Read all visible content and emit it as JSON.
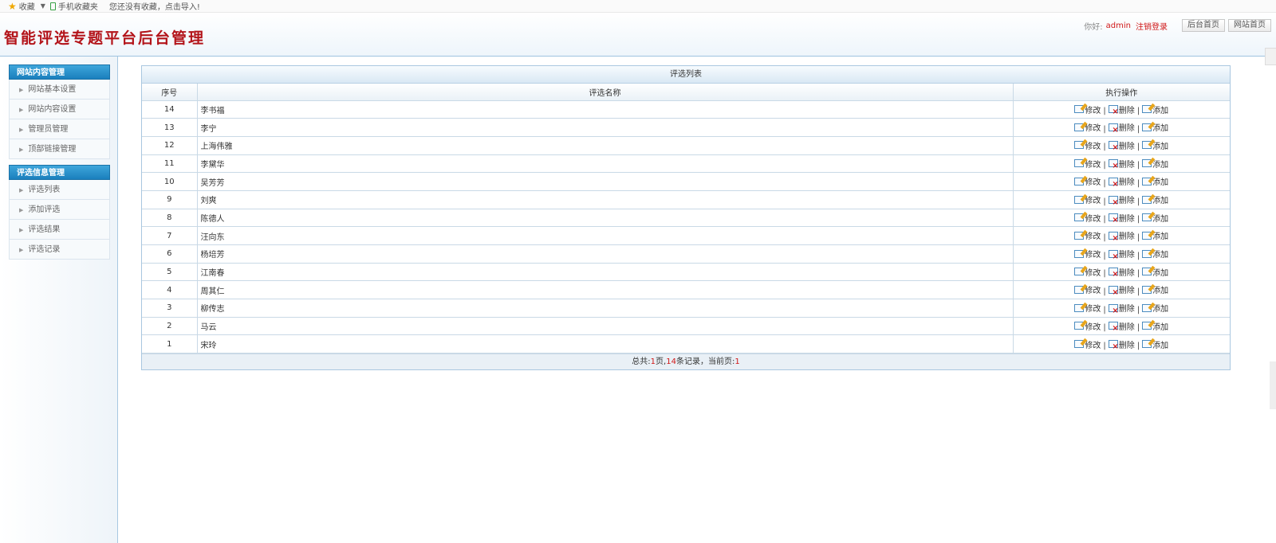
{
  "bookmark_bar": {
    "favorites_label": "收藏",
    "mobile_favorites_label": "手机收藏夹",
    "tip": "您还没有收藏，点击导入!"
  },
  "header": {
    "title": "智能评选专题平台后台管理",
    "greeting": "你好:",
    "username": "admin",
    "logout": "注销登录",
    "btn_admin_home": "后台首页",
    "btn_site_home": "网站首页"
  },
  "sidebar": {
    "groups": [
      {
        "title": "网站内容管理",
        "items": [
          "网站基本设置",
          "网站内容设置",
          "管理员管理",
          "顶部链接管理"
        ]
      },
      {
        "title": "评选信息管理",
        "items": [
          "评选列表",
          "添加评选",
          "评选结果",
          "评选记录"
        ]
      }
    ]
  },
  "table": {
    "caption": "评选列表",
    "headers": {
      "id": "序号",
      "name": "评选名称",
      "ops": "执行操作"
    },
    "actions": {
      "edit": "修改",
      "delete": "删除",
      "add": "添加",
      "separator": "|"
    },
    "rows": [
      {
        "id": "14",
        "name": "李书福"
      },
      {
        "id": "13",
        "name": "李宁"
      },
      {
        "id": "12",
        "name": "上海伟雅"
      },
      {
        "id": "11",
        "name": "李黛华"
      },
      {
        "id": "10",
        "name": "吴芳芳"
      },
      {
        "id": "9",
        "name": "刘爽"
      },
      {
        "id": "8",
        "name": "陈德人"
      },
      {
        "id": "7",
        "name": "汪向东"
      },
      {
        "id": "6",
        "name": "杨培芳"
      },
      {
        "id": "5",
        "name": "江南春"
      },
      {
        "id": "4",
        "name": "周其仁"
      },
      {
        "id": "3",
        "name": "柳传志"
      },
      {
        "id": "2",
        "name": "马云"
      },
      {
        "id": "1",
        "name": "宋玲"
      }
    ],
    "footer": {
      "total_prefix": "总共:",
      "total_pages": "1",
      "pages_suffix": "页,",
      "records": "14",
      "records_suffix": "条记录，当前页:",
      "current_page": "1"
    }
  },
  "colors": {
    "title_red": "#b3141a",
    "nav_head_blue": "#1a7fbd",
    "accent_red": "#d01818"
  }
}
